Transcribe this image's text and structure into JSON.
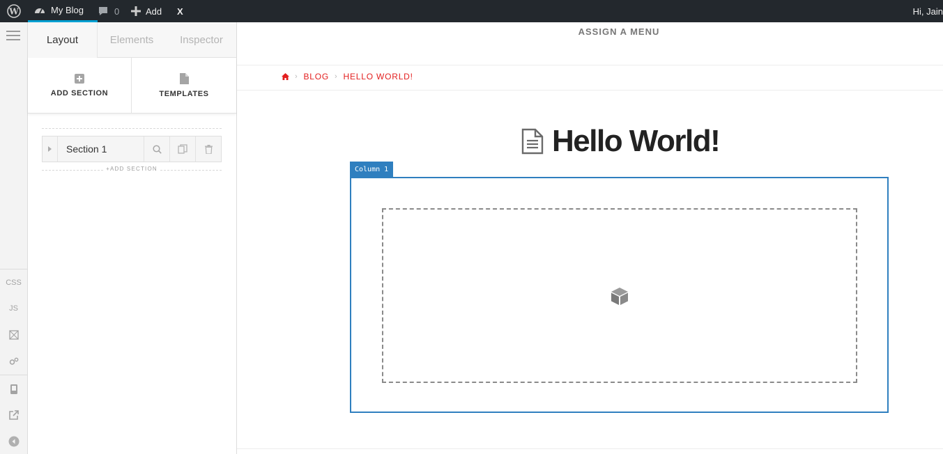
{
  "admin_bar": {
    "site_name": "My Blog",
    "comment_count": "0",
    "add_label": "Add",
    "x_label": "X",
    "greeting": "Hi, Jain"
  },
  "rail": {
    "css_label": "CSS",
    "js_label": "JS"
  },
  "panel": {
    "tabs": [
      {
        "label": "Layout"
      },
      {
        "label": "Elements"
      },
      {
        "label": "Inspector"
      }
    ],
    "actions": {
      "add_section": "ADD SECTION",
      "templates": "TEMPLATES"
    },
    "sections": [
      {
        "label": "Section 1"
      }
    ],
    "add_section_small": "+ADD SECTION"
  },
  "preview": {
    "menu_label": "ASSIGN A MENU",
    "breadcrumb": [
      "BLOG",
      "HELLO WORLD!"
    ],
    "page_title": "Hello World!",
    "column_label": "Column 1"
  },
  "colors": {
    "admin_bar_bg": "#23282d",
    "accent_blue": "#2f7fbf",
    "breadcrumb_red": "#e31e1e"
  }
}
